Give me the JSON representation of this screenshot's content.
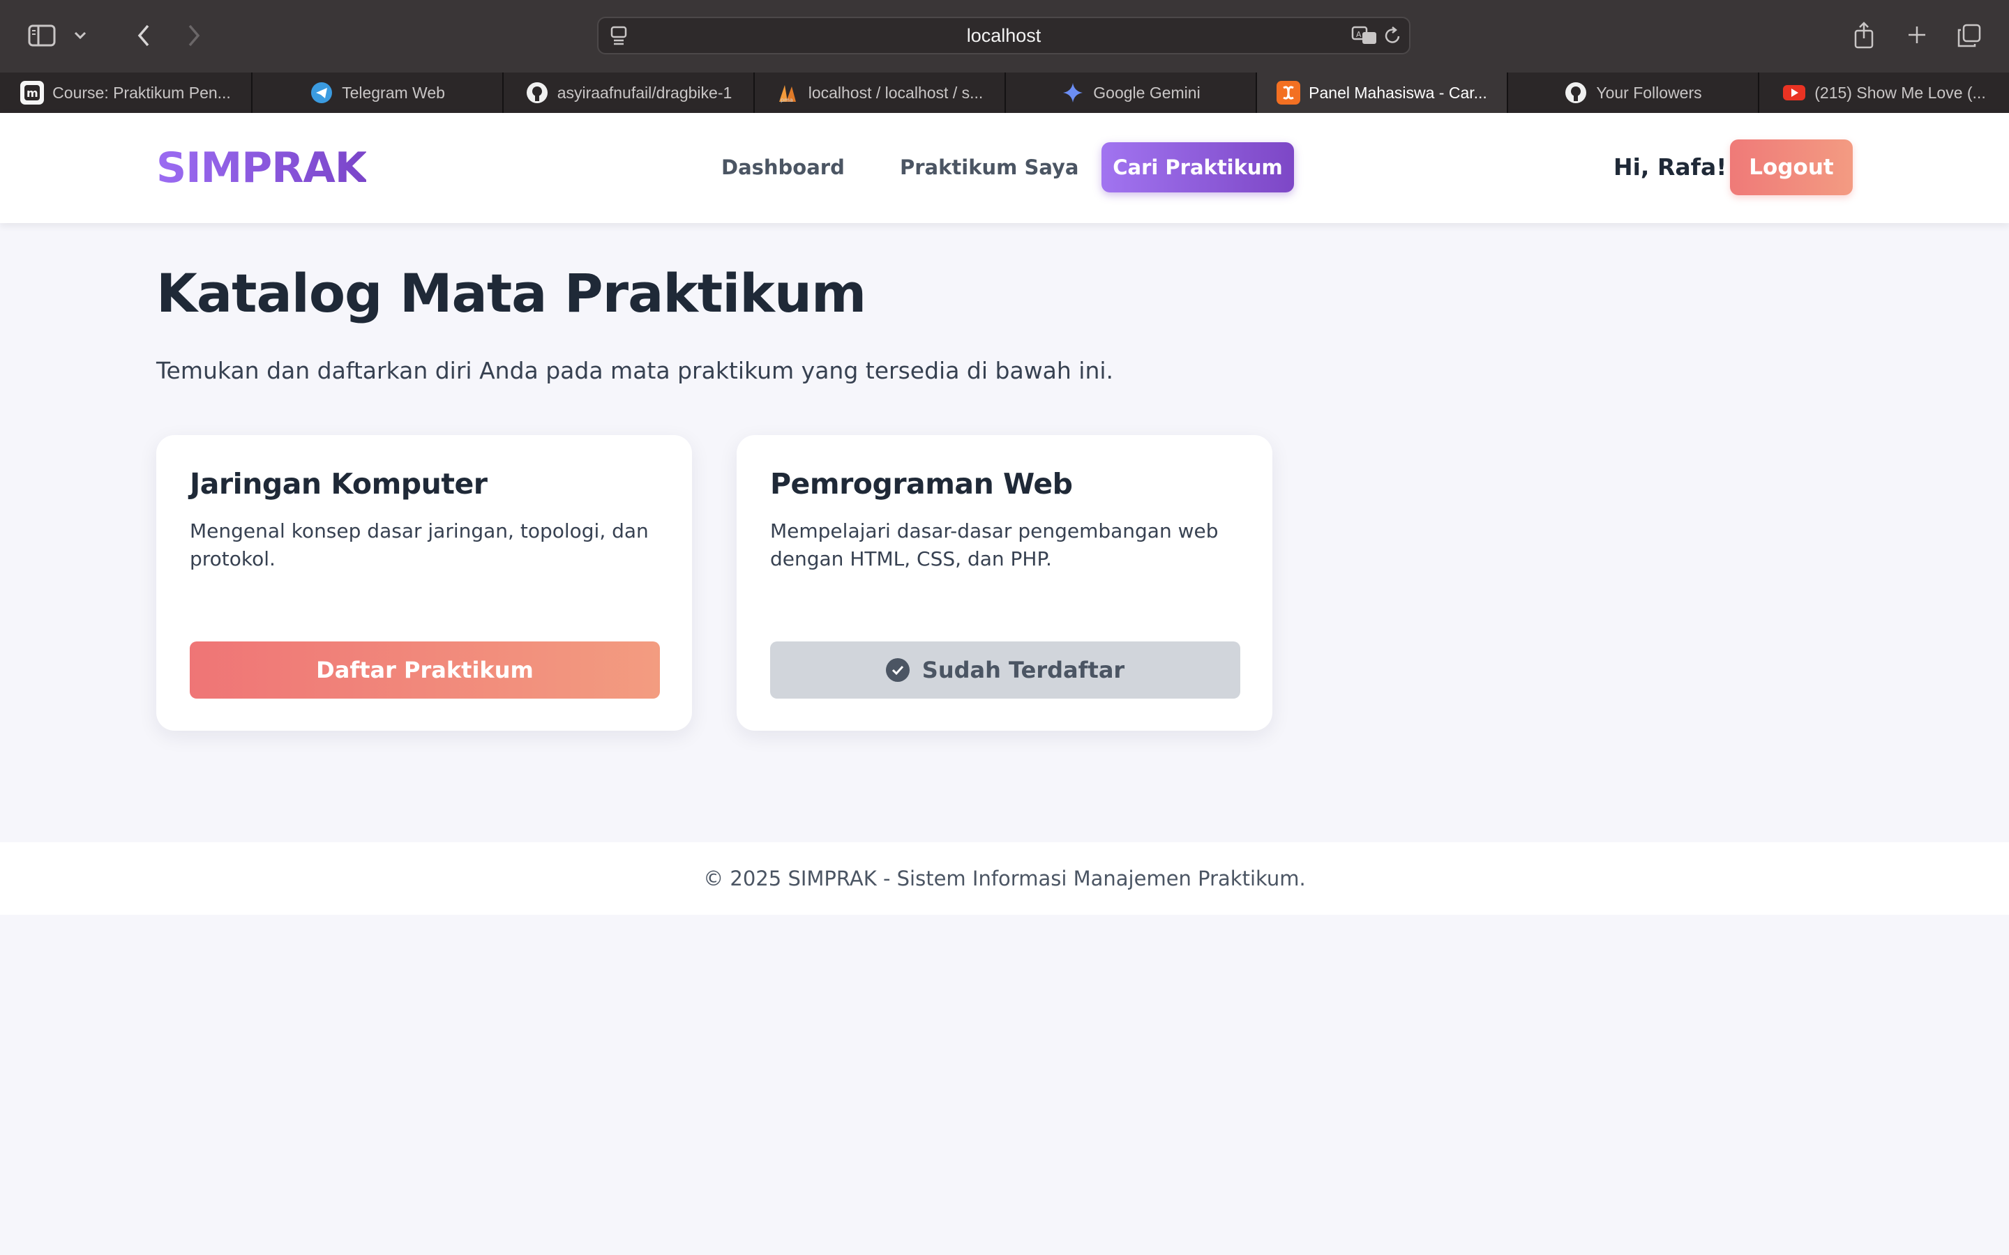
{
  "browser": {
    "url": "localhost",
    "tabs": [
      {
        "label": "Course: Praktikum Pen...",
        "icon": "moodle-icon",
        "active": false
      },
      {
        "label": "Telegram Web",
        "icon": "telegram-icon",
        "active": false
      },
      {
        "label": "asyiraafnufail/dragbike-1",
        "icon": "github-icon",
        "active": false
      },
      {
        "label": "localhost / localhost / s...",
        "icon": "phpmyadmin-icon",
        "active": false
      },
      {
        "label": "Google Gemini",
        "icon": "gemini-icon",
        "active": false
      },
      {
        "label": "Panel Mahasiswa - Car...",
        "icon": "xampp-icon",
        "active": true
      },
      {
        "label": "Your Followers",
        "icon": "github-icon",
        "active": false
      },
      {
        "label": "(215) Show Me Love (...",
        "icon": "youtube-icon",
        "active": false
      }
    ]
  },
  "header": {
    "brand": "SIMPRAK",
    "nav": [
      {
        "label": "Dashboard",
        "active": false
      },
      {
        "label": "Praktikum Saya",
        "active": false
      },
      {
        "label": "Cari Praktikum",
        "active": true
      }
    ],
    "greeting": "Hi, Rafa!",
    "logout_label": "Logout"
  },
  "main": {
    "title": "Katalog Mata Praktikum",
    "subtitle": "Temukan dan daftarkan diri Anda pada mata praktikum yang tersedia di bawah ini.",
    "courses": [
      {
        "title": "Jaringan Komputer",
        "description": "Mengenal konsep dasar jaringan, topologi, dan protokol.",
        "action_label": "Daftar Praktikum",
        "enrolled": false
      },
      {
        "title": "Pemrograman Web",
        "description": "Mempelajari dasar-dasar pengembangan web dengan HTML, CSS, dan PHP.",
        "action_label": "Sudah Terdaftar",
        "enrolled": true
      }
    ]
  },
  "footer": {
    "text": "© 2025 SIMPRAK - Sistem Informasi Manajemen Praktikum."
  },
  "colors": {
    "brand": "#8b5cf6",
    "primary_button": "#ef7576",
    "disabled_button": "#d1d5db",
    "page_background": "#f6f6fb"
  }
}
